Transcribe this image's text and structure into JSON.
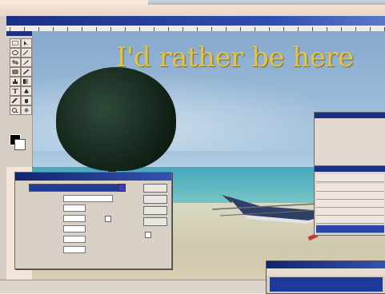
{
  "canvas": {
    "headline": "I'd rather be here"
  },
  "dialog": {
    "title": "",
    "buttons": [
      "",
      "",
      "",
      ""
    ]
  },
  "taskbar_window": {
    "title": ""
  },
  "colors": {
    "titlebar": "#1b2f86",
    "headline": "#e4c34a",
    "selection": "#2a47a5"
  },
  "icons": [
    "marquee-icon",
    "move-icon",
    "lasso-icon",
    "magic-wand-icon",
    "crop-icon",
    "brush-icon",
    "eraser-icon",
    "pencil-icon",
    "stamp-icon",
    "gradient-icon",
    "text-icon",
    "pen-icon",
    "eyedropper-icon",
    "hand-icon",
    "zoom-icon",
    "eye-icon"
  ]
}
